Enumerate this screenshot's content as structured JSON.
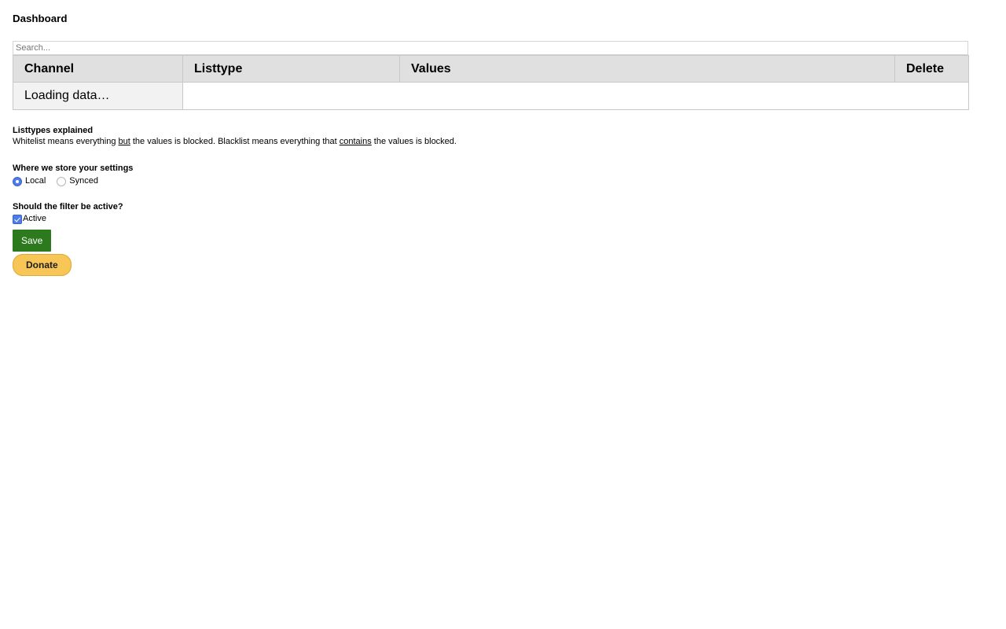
{
  "page": {
    "title": "Dashboard"
  },
  "search": {
    "placeholder": "Search...",
    "value": ""
  },
  "table": {
    "columns": [
      {
        "key": "channel",
        "label": "Channel"
      },
      {
        "key": "listtype",
        "label": "Listtype"
      },
      {
        "key": "values",
        "label": "Values"
      },
      {
        "key": "delete",
        "label": "Delete"
      }
    ],
    "rows": [
      {
        "channel": "Loading data…",
        "listtype": "",
        "values": "",
        "delete": ""
      }
    ],
    "loading_text": "Loading data…"
  },
  "listtypes": {
    "heading": "Listtypes explained",
    "text_part1": "Whitelist means everything ",
    "emphasis1": "but",
    "text_part2": " the values is blocked. Blacklist means everything that ",
    "emphasis2": "contains",
    "text_part3": " the values is blocked."
  },
  "storage": {
    "heading": "Where we store your settings",
    "options": [
      {
        "label": "Local",
        "selected": true
      },
      {
        "label": "Synced",
        "selected": false
      }
    ]
  },
  "filter": {
    "heading": "Should the filter be active?",
    "checkbox_label": "Active",
    "checked": true
  },
  "actions": {
    "save_label": "Save",
    "donate_label": "Donate"
  },
  "colors": {
    "accent_blue": "#4e7ce8",
    "save_green": "#2c7a1d",
    "donate_gold": "#f7c657",
    "header_gray": "#e0e0e0",
    "cell_gray": "#f2f2f2",
    "border_gray": "#c8c8c8"
  }
}
